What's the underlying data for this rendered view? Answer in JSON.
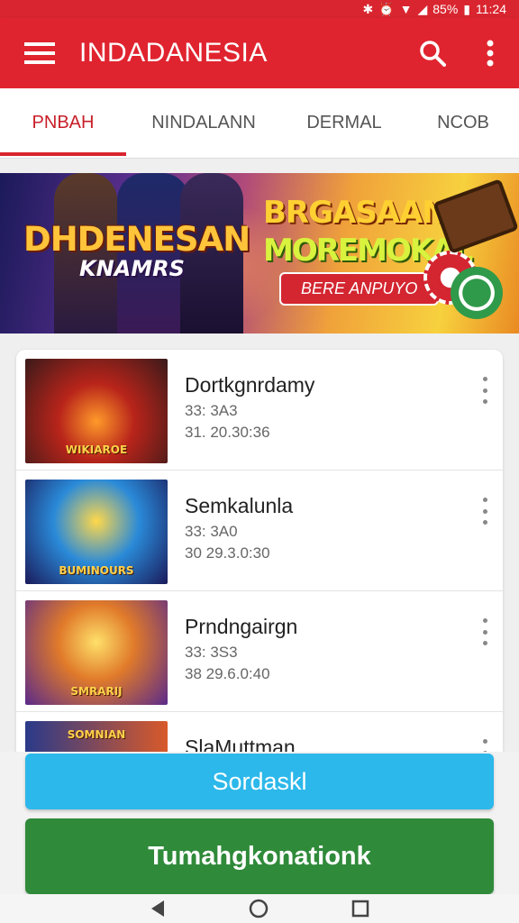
{
  "status_bar": {
    "battery": "85%",
    "time": "11:24"
  },
  "app_bar": {
    "title": "INDADANESIA",
    "menu_icon": "menu-icon",
    "search_icon": "search-icon",
    "more_icon": "more-vert-icon"
  },
  "tabs": [
    {
      "label": "PNBAH",
      "active": true
    },
    {
      "label": "NINDALANN",
      "active": false
    },
    {
      "label": "DERMAL",
      "active": false
    },
    {
      "label": "NCOB",
      "active": false
    }
  ],
  "banner": {
    "left_title": "DHDENESAN",
    "left_subtitle": "KNAMRS",
    "right_title_1": "BRGASAANIAN",
    "right_title_2": "MOREMOKAL",
    "button": "BERE ANPUYO"
  },
  "list": [
    {
      "name": "Dortkgnrdamy",
      "meta1": "33: 3A3",
      "meta2": "31. 20.30:36",
      "thumb_label": "WIKIAROE"
    },
    {
      "name": "Semkalunla",
      "meta1": "33: 3A0",
      "meta2": "30 29.3.0:30",
      "thumb_label": "BUMINOURS"
    },
    {
      "name": "Prndngairgn",
      "meta1": "33: 3S3",
      "meta2": "38 29.6.0:40",
      "thumb_label": "SMRARIJ"
    },
    {
      "name": "SlaMuttman",
      "meta1": "",
      "meta2": "",
      "thumb_label": "SOMNIAN"
    }
  ],
  "buttons": {
    "primary": "Sordaskl",
    "secondary": "Tumahgkonationk"
  },
  "colors": {
    "appbar": "#e0242f",
    "primary_button": "#2cb8ea",
    "secondary_button": "#2f8a3a"
  }
}
